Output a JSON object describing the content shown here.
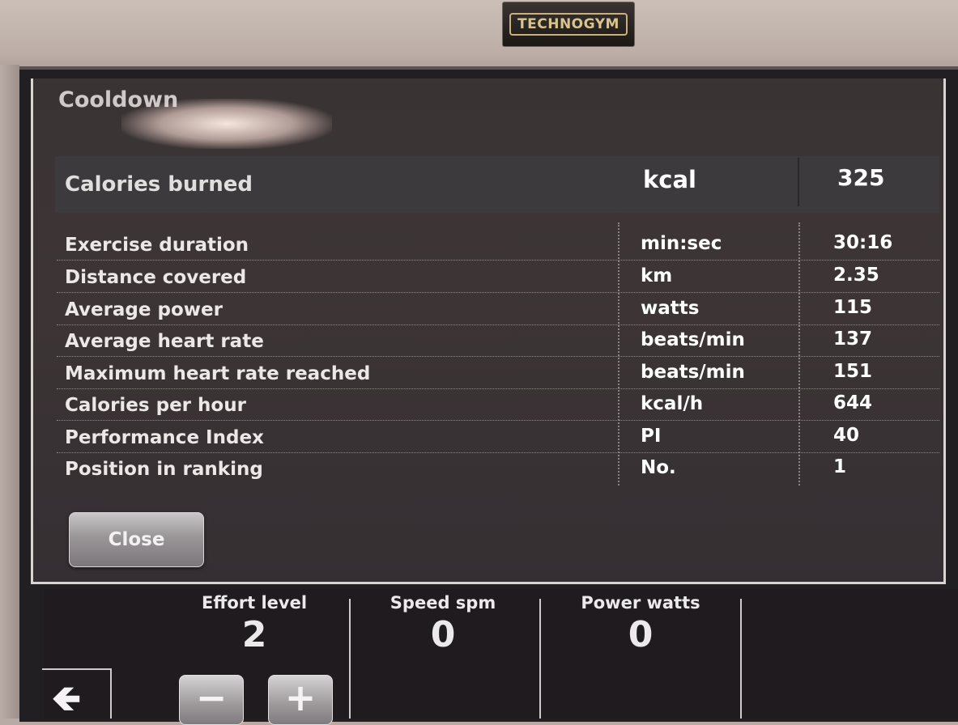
{
  "brand": {
    "logo_text": "TECHNOGYM"
  },
  "screen": {
    "title": "Cooldown"
  },
  "summary": {
    "label": "Calories burned",
    "unit": "kcal",
    "value": "325"
  },
  "rows": [
    {
      "label": "Exercise duration",
      "unit": "min:sec",
      "value": "30:16"
    },
    {
      "label": "Distance covered",
      "unit": "km",
      "value": "2.35"
    },
    {
      "label": "Average power",
      "unit": "watts",
      "value": "115"
    },
    {
      "label": "Average heart rate",
      "unit": "beats/min",
      "value": "137"
    },
    {
      "label": "Maximum heart rate reached",
      "unit": "beats/min",
      "value": "151"
    },
    {
      "label": "Calories per hour",
      "unit": "kcal/h",
      "value": "644"
    },
    {
      "label": "Performance Index",
      "unit": "PI",
      "value": "40"
    },
    {
      "label": "Position in ranking",
      "unit": "No.",
      "value": "1"
    }
  ],
  "actions": {
    "close_label": "Close"
  },
  "bottom_bar": {
    "effort": {
      "label": "Effort level",
      "value": "2"
    },
    "speed": {
      "label": "Speed spm",
      "value": "0"
    },
    "power": {
      "label": "Power watts",
      "value": "0"
    },
    "minus_symbol": "−",
    "plus_symbol": "+",
    "back_symbol": "🡸"
  },
  "icons": [
    "back-arrow-icon",
    "minus-icon",
    "plus-icon"
  ]
}
